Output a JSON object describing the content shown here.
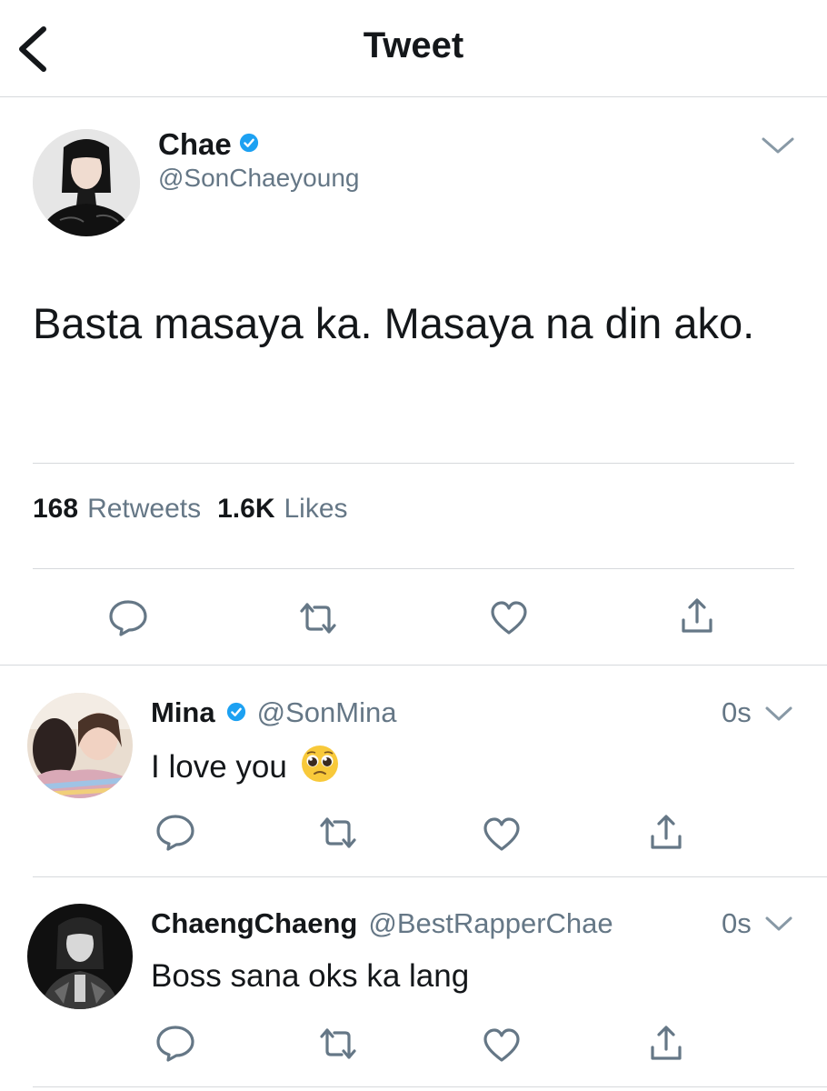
{
  "header": {
    "title": "Tweet"
  },
  "main_tweet": {
    "name": "Chae",
    "handle": "@SonChaeyoung",
    "text": "Basta masaya ka. Masaya na din ako.",
    "retweets_count": "168",
    "retweets_label": "Retweets",
    "likes_count": "1.6K",
    "likes_label": "Likes"
  },
  "replies": [
    {
      "name": "Mina",
      "handle": "@SonMina",
      "time": "0s",
      "text": "I love you",
      "emoji": "🥺",
      "verified": true
    },
    {
      "name": "ChaengChaeng",
      "handle": "@BestRapperChae",
      "time": "0s",
      "text": "Boss sana oks ka lang",
      "verified": false
    }
  ],
  "colors": {
    "verified_blue": "#1da1f2",
    "icon_gray": "#657786",
    "divider": "#d6d9dc"
  },
  "icons": [
    "back-arrow-icon",
    "chevron-down-icon",
    "verified-badge-icon",
    "reply-icon",
    "retweet-icon",
    "like-icon",
    "share-icon"
  ]
}
